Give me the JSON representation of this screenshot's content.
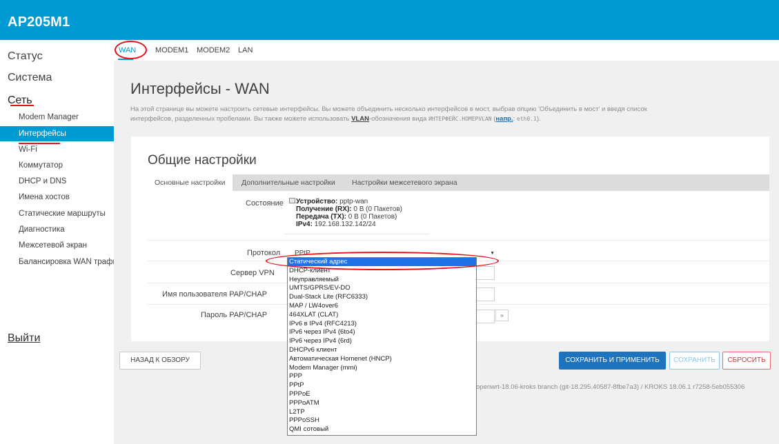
{
  "header": {
    "brand": "AP205M1"
  },
  "sidebar": {
    "top": [
      "Статус",
      "Система",
      "Сеть"
    ],
    "items": [
      "Modem Manager",
      "Интерфейсы",
      "Wi-Fi",
      "Коммутатор",
      "DHCP и DNS",
      "Имена хостов",
      "Статические маршруты",
      "Диагностика",
      "Межсетевой экран",
      "Балансировка WAN трафик"
    ],
    "logout": "Выйти"
  },
  "tabs": [
    "WAN",
    "MODEM1",
    "MODEM2",
    "LAN"
  ],
  "page": {
    "title": "Интерфейсы - WAN",
    "desc_1": "На этой странице вы можете настроить сетевые интерфейсы. Вы можете объединить несколько интерфейсов в мост, выбрав опцию 'Объединить в мост' и введя список",
    "desc_2a": "интерфейсов, разделенных пробелами. Вы также можете использовать ",
    "desc_vlan": "VLAN",
    "desc_2b": "-обозначения вида ",
    "desc_mono": "ИНТЕРФЕЙС.НОМЕРVLAN",
    "desc_2c": " (",
    "desc_link": "напр.",
    "desc_2d": ": ",
    "desc_mono2": "eth0.1",
    "desc_2e": ")."
  },
  "card": {
    "title": "Общие настройки",
    "subtabs": [
      "Основные настройки",
      "Дополнительные настройки",
      "Настройки межсетевого экрана"
    ],
    "status_label": "Состояние",
    "status": {
      "device_label": "Устройство:",
      "device_value": "pptp-wan",
      "rx_label": "Получение (RX):",
      "rx_value": "0 B (0 Пакетов)",
      "tx_label": "Передача (TX):",
      "tx_value": "0 B (0 Пакетов)",
      "ipv4_label": "IPv4:",
      "ipv4_value": "192.168.132.142/24"
    },
    "protocol_label": "Протокол",
    "protocol_value": "PPtP",
    "vpn_label": "Сервер VPN",
    "user_label": "Имя пользователя PAP/CHAP",
    "pass_label": "Пароль PAP/CHAP"
  },
  "dropdown": {
    "options": [
      "Статический адрес",
      "DHCP-клиент",
      "Неуправляемый",
      "UMTS/GPRS/EV-DO",
      "Dual-Stack Lite (RFC6333)",
      "MAP / LW4over6",
      "464XLAT (CLAT)",
      "IPv6 в IPv4 (RFC4213)",
      "IPv6 через IPv4 (6to4)",
      "IPv6 через IPv4 (6rd)",
      "DHCPv6 клиент",
      "Автоматическая Homenet (HNCP)",
      "Modem Manager (mmi)",
      "PPP",
      "PPtP",
      "PPPoE",
      "PPPoATM",
      "L2TP",
      "PPPoSSH",
      "QMI сотовый"
    ],
    "highlighted": "Статический адрес"
  },
  "buttons": {
    "back": "НАЗАД К ОБЗОРУ",
    "apply": "СОХРАНИТЬ И ПРИМЕНИТЬ",
    "save": "СОХРАНИТЬ",
    "reset": "СБРОСИТЬ"
  },
  "footer": "openwrt-18.06-kroks branch (git-18.295.40587-8fbe7a3) / KROKS 18.06.1 r7258-5eb055306",
  "colors": {
    "accent": "#009bd5",
    "annotation": "#e8101a",
    "highlight": "#1e73e8"
  }
}
